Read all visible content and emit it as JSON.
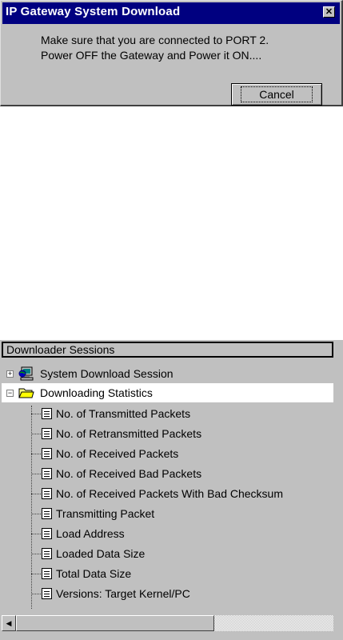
{
  "dialog": {
    "title": "IP Gateway System Download",
    "close_glyph": "✕",
    "message_line1": "Make sure that you are connected to PORT 2.",
    "message_line2": "Power OFF the Gateway and Power  it ON....",
    "cancel_label": "Cancel"
  },
  "tree": {
    "header": "Downloader Sessions",
    "nodes": [
      {
        "label": "System Download Session",
        "icon": "network-computer-icon",
        "expander": "+"
      },
      {
        "label": "Downloading Statistics",
        "icon": "folder-open-icon",
        "expander": "−"
      }
    ],
    "children": [
      {
        "label": "No. of Transmitted Packets",
        "icon": "document-icon"
      },
      {
        "label": "No. of Retransmitted Packets",
        "icon": "document-icon"
      },
      {
        "label": "No. of Received Packets",
        "icon": "document-icon"
      },
      {
        "label": "No. of Received Bad Packets",
        "icon": "document-icon"
      },
      {
        "label": "No. of Received Packets With Bad Checksum",
        "icon": "document-icon"
      },
      {
        "label": "Transmitting Packet",
        "icon": "document-icon"
      },
      {
        "label": "Load Address",
        "icon": "document-icon"
      },
      {
        "label": "Loaded Data Size",
        "icon": "document-icon"
      },
      {
        "label": "Total Data Size",
        "icon": "document-icon"
      },
      {
        "label": "Versions: Target Kernel/PC",
        "icon": "document-icon"
      }
    ]
  },
  "scrollbar": {
    "left_arrow": "◀"
  }
}
